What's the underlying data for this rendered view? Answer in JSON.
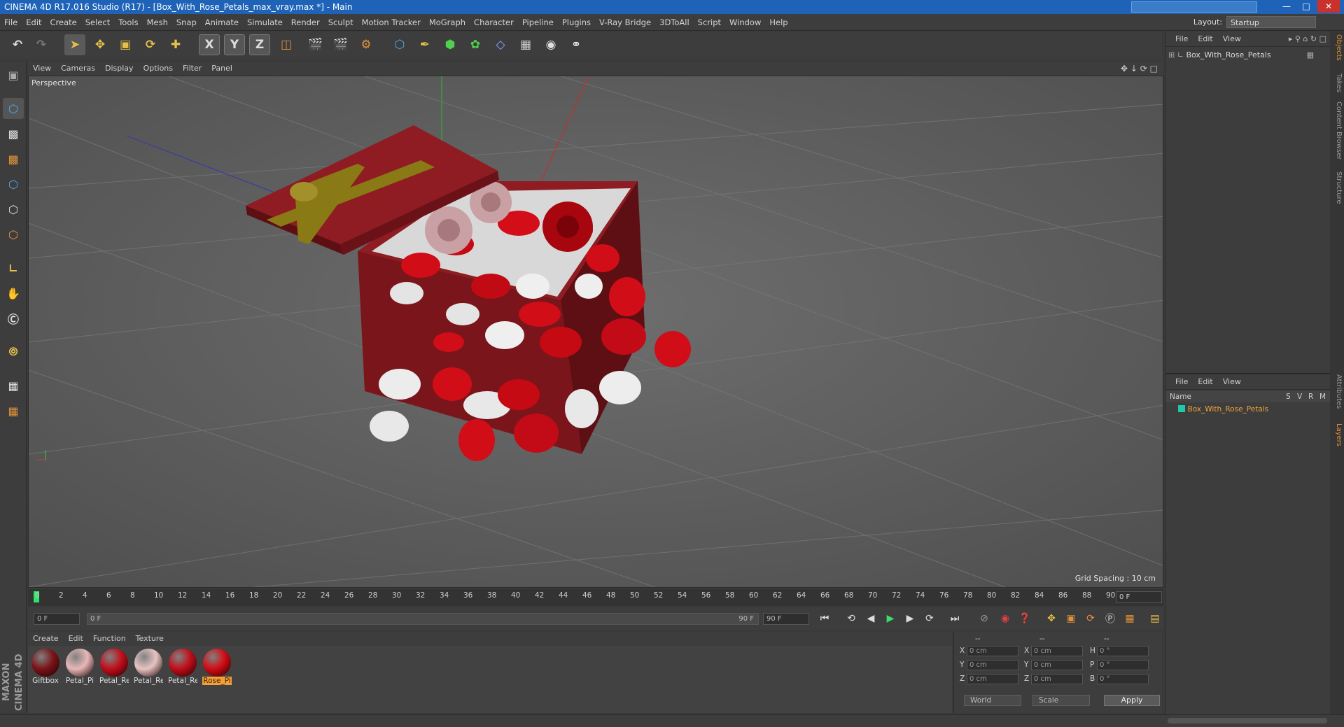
{
  "window": {
    "title": "CINEMA 4D R17.016 Studio (R17) - [Box_With_Rose_Petals_max_vray.max *] - Main"
  },
  "menubar": {
    "items": [
      "File",
      "Edit",
      "Create",
      "Select",
      "Tools",
      "Mesh",
      "Snap",
      "Animate",
      "Simulate",
      "Render",
      "Sculpt",
      "Motion Tracker",
      "MoGraph",
      "Character",
      "Pipeline",
      "Plugins",
      "V-Ray Bridge",
      "3DToAll",
      "Script",
      "Window",
      "Help"
    ],
    "layout_label": "Layout:",
    "layout_value": "Startup"
  },
  "toolbar": {
    "x": "X",
    "y": "Y",
    "z": "Z"
  },
  "viewport": {
    "menu": [
      "View",
      "Cameras",
      "Display",
      "Options",
      "Filter",
      "Panel"
    ],
    "camera_label": "Perspective",
    "grid_spacing": "Grid Spacing : 10 cm"
  },
  "timeline": {
    "ticks": [
      "0",
      "2",
      "4",
      "6",
      "8",
      "10",
      "12",
      "14",
      "16",
      "18",
      "20",
      "22",
      "24",
      "26",
      "28",
      "30",
      "32",
      "34",
      "36",
      "38",
      "40",
      "42",
      "44",
      "46",
      "48",
      "50",
      "52",
      "54",
      "56",
      "58",
      "60",
      "62",
      "64",
      "66",
      "68",
      "70",
      "72",
      "74",
      "76",
      "78",
      "80",
      "82",
      "84",
      "86",
      "88",
      "90"
    ],
    "current_frame": "0 F"
  },
  "transport": {
    "start": "0 F",
    "range_start": "0 F",
    "range_end": "90 F",
    "end": "90 F"
  },
  "materials": {
    "menu": [
      "Create",
      "Edit",
      "Function",
      "Texture"
    ],
    "items": [
      {
        "name": "Giftbox",
        "color": "#7a1418"
      },
      {
        "name": "Petal_Pi",
        "color": "#e8b7b7"
      },
      {
        "name": "Petal_Re",
        "color": "#c10e1a"
      },
      {
        "name": "Petal_Re",
        "color": "#e8c3c3"
      },
      {
        "name": "Petal_Re",
        "color": "#c10e1a"
      },
      {
        "name": "Rose_Pi",
        "color": "#d40c14"
      }
    ]
  },
  "coords": {
    "header": [
      "--",
      "--",
      "--"
    ],
    "rows": [
      {
        "a": "X",
        "av": "0 cm",
        "b": "X",
        "bv": "0 cm",
        "c": "H",
        "cv": "0 °"
      },
      {
        "a": "Y",
        "av": "0 cm",
        "b": "Y",
        "bv": "0 cm",
        "c": "P",
        "cv": "0 °"
      },
      {
        "a": "Z",
        "av": "0 cm",
        "b": "Z",
        "bv": "0 cm",
        "c": "B",
        "cv": "0 °"
      }
    ],
    "mode": "World",
    "scale": "Scale",
    "apply": "Apply"
  },
  "objects": {
    "menu": [
      "File",
      "Edit",
      "View"
    ],
    "item": "Box_With_Rose_Petals"
  },
  "layers": {
    "menu": [
      "File",
      "Edit",
      "View"
    ],
    "col_name": "Name",
    "cols": [
      "S",
      "V",
      "R",
      "M"
    ],
    "item": "Box_With_Rose_Petals"
  },
  "right_tabs": [
    "Objects",
    "Takes",
    "Content Browser",
    "Structure",
    "Attributes",
    "Layers"
  ],
  "brand": "MAXON CINEMA 4D"
}
